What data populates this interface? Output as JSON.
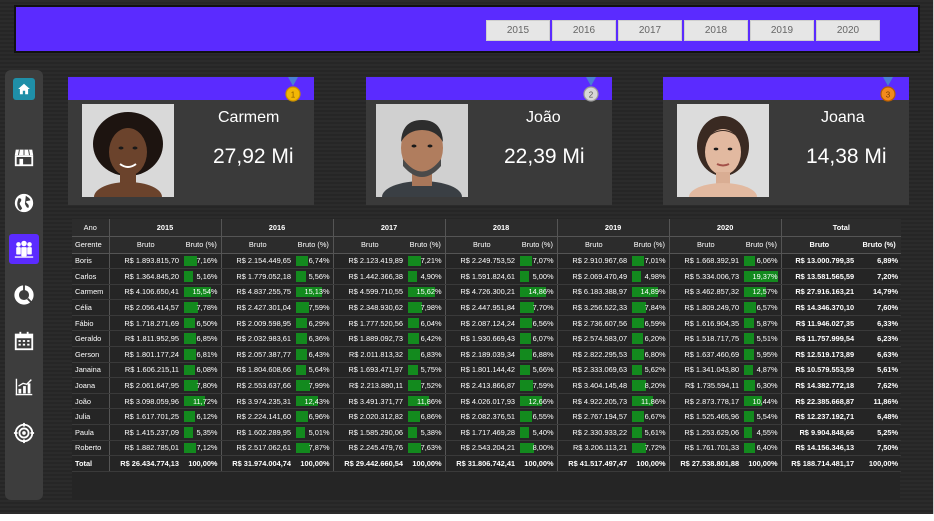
{
  "years": [
    "2015",
    "2016",
    "2017",
    "2018",
    "2019",
    "2020"
  ],
  "cards": [
    {
      "name": "Carmem",
      "value": "27,92 Mi",
      "medal": "1"
    },
    {
      "name": "João",
      "value": "22,39 Mi",
      "medal": "2"
    },
    {
      "name": "Joana",
      "value": "14,38 Mi",
      "medal": "3"
    }
  ],
  "table": {
    "col_ano": "Ano",
    "col_gerente": "Gerente",
    "col_total": "Total",
    "sub_bruto": "Bruto",
    "sub_pct": "Bruto (%)",
    "rows": [
      {
        "name": "Boris",
        "cells": [
          [
            "R$ 1.893.815,70",
            "7,16%"
          ],
          [
            "R$ 2.154.449,65",
            "6,74%"
          ],
          [
            "R$ 2.123.419,89",
            "7,21%"
          ],
          [
            "R$ 2.249.753,52",
            "7,07%"
          ],
          [
            "R$ 2.910.967,68",
            "7,01%"
          ],
          [
            "R$ 1.668.392,91",
            "6,06%"
          ]
        ],
        "total": [
          "R$ 13.000.799,35",
          "6,89%"
        ]
      },
      {
        "name": "Carlos",
        "cells": [
          [
            "R$ 1.364.845,20",
            "5,16%"
          ],
          [
            "R$ 1.779.052,18",
            "5,56%"
          ],
          [
            "R$ 1.442.366,38",
            "4,90%"
          ],
          [
            "R$ 1.591.824,61",
            "5,00%"
          ],
          [
            "R$ 2.069.470,49",
            "4,98%"
          ],
          [
            "R$ 5.334.006,73",
            "19,37%"
          ]
        ],
        "total": [
          "R$ 13.581.565,59",
          "7,20%"
        ]
      },
      {
        "name": "Carmem",
        "cells": [
          [
            "R$ 4.106.650,41",
            "15,54%"
          ],
          [
            "R$ 4.837.255,75",
            "15,13%"
          ],
          [
            "R$ 4.599.710,55",
            "15,62%"
          ],
          [
            "R$ 4.726.300,21",
            "14,86%"
          ],
          [
            "R$ 6.183.388,97",
            "14,89%"
          ],
          [
            "R$ 3.462.857,32",
            "12,57%"
          ]
        ],
        "total": [
          "R$ 27.916.163,21",
          "14,79%"
        ]
      },
      {
        "name": "Célia",
        "cells": [
          [
            "R$ 2.056.414,57",
            "7,78%"
          ],
          [
            "R$ 2.427.301,04",
            "7,59%"
          ],
          [
            "R$ 2.348.930,62",
            "7,98%"
          ],
          [
            "R$ 2.447.951,84",
            "7,70%"
          ],
          [
            "R$ 3.256.522,33",
            "7,84%"
          ],
          [
            "R$ 1.809.249,70",
            "6,57%"
          ]
        ],
        "total": [
          "R$ 14.346.370,10",
          "7,60%"
        ]
      },
      {
        "name": "Fábio",
        "cells": [
          [
            "R$ 1.718.271,69",
            "6,50%"
          ],
          [
            "R$ 2.009.598,95",
            "6,29%"
          ],
          [
            "R$ 1.777.520,56",
            "6,04%"
          ],
          [
            "R$ 2.087.124,24",
            "6,56%"
          ],
          [
            "R$ 2.736.607,56",
            "6,59%"
          ],
          [
            "R$ 1.616.904,35",
            "5,87%"
          ]
        ],
        "total": [
          "R$ 11.946.027,35",
          "6,33%"
        ]
      },
      {
        "name": "Geraldo",
        "cells": [
          [
            "R$ 1.811.952,95",
            "6,85%"
          ],
          [
            "R$ 2.032.983,61",
            "6,36%"
          ],
          [
            "R$ 1.889.092,73",
            "6,42%"
          ],
          [
            "R$ 1.930.669,43",
            "6,07%"
          ],
          [
            "R$ 2.574.583,07",
            "6,20%"
          ],
          [
            "R$ 1.518.717,75",
            "5,51%"
          ]
        ],
        "total": [
          "R$ 11.757.999,54",
          "6,23%"
        ]
      },
      {
        "name": "Gerson",
        "cells": [
          [
            "R$ 1.801.177,24",
            "6,81%"
          ],
          [
            "R$ 2.057.387,77",
            "6,43%"
          ],
          [
            "R$ 2.011.813,32",
            "6,83%"
          ],
          [
            "R$ 2.189.039,34",
            "6,88%"
          ],
          [
            "R$ 2.822.295,53",
            "6,80%"
          ],
          [
            "R$ 1.637.460,69",
            "5,95%"
          ]
        ],
        "total": [
          "R$ 12.519.173,89",
          "6,63%"
        ]
      },
      {
        "name": "Janaina",
        "cells": [
          [
            "R$ 1.606.215,11",
            "6,08%"
          ],
          [
            "R$ 1.804.608,66",
            "5,64%"
          ],
          [
            "R$ 1.693.471,97",
            "5,75%"
          ],
          [
            "R$ 1.801.144,42",
            "5,66%"
          ],
          [
            "R$ 2.333.069,63",
            "5,62%"
          ],
          [
            "R$ 1.341.043,80",
            "4,87%"
          ]
        ],
        "total": [
          "R$ 10.579.553,59",
          "5,61%"
        ]
      },
      {
        "name": "Joana",
        "cells": [
          [
            "R$ 2.061.647,95",
            "7,80%"
          ],
          [
            "R$ 2.553.637,66",
            "7,99%"
          ],
          [
            "R$ 2.213.880,11",
            "7,52%"
          ],
          [
            "R$ 2.413.866,87",
            "7,59%"
          ],
          [
            "R$ 3.404.145,48",
            "8,20%"
          ],
          [
            "R$ 1.735.594,11",
            "6,30%"
          ]
        ],
        "total": [
          "R$ 14.382.772,18",
          "7,62%"
        ]
      },
      {
        "name": "João",
        "cells": [
          [
            "R$ 3.098.059,96",
            "11,72%"
          ],
          [
            "R$ 3.974.235,31",
            "12,43%"
          ],
          [
            "R$ 3.491.371,77",
            "11,86%"
          ],
          [
            "R$ 4.026.017,93",
            "12,66%"
          ],
          [
            "R$ 4.922.205,73",
            "11,86%"
          ],
          [
            "R$ 2.873.778,17",
            "10,44%"
          ]
        ],
        "total": [
          "R$ 22.385.668,87",
          "11,86%"
        ]
      },
      {
        "name": "Julia",
        "cells": [
          [
            "R$ 1.617.701,25",
            "6,12%"
          ],
          [
            "R$ 2.224.141,60",
            "6,96%"
          ],
          [
            "R$ 2.020.312,82",
            "6,86%"
          ],
          [
            "R$ 2.082.376,51",
            "6,55%"
          ],
          [
            "R$ 2.767.194,57",
            "6,67%"
          ],
          [
            "R$ 1.525.465,96",
            "5,54%"
          ]
        ],
        "total": [
          "R$ 12.237.192,71",
          "6,48%"
        ]
      },
      {
        "name": "Paula",
        "cells": [
          [
            "R$ 1.415.237,09",
            "5,35%"
          ],
          [
            "R$ 1.602.289,95",
            "5,01%"
          ],
          [
            "R$ 1.585.290,06",
            "5,38%"
          ],
          [
            "R$ 1.717.469,28",
            "5,40%"
          ],
          [
            "R$ 2.330.933,22",
            "5,61%"
          ],
          [
            "R$ 1.253.629,06",
            "4,55%"
          ]
        ],
        "total": [
          "R$ 9.904.848,66",
          "5,25%"
        ]
      },
      {
        "name": "Roberto",
        "cells": [
          [
            "R$ 1.882.785,01",
            "7,12%"
          ],
          [
            "R$ 2.517.062,61",
            "7,87%"
          ],
          [
            "R$ 2.245.479,76",
            "7,63%"
          ],
          [
            "R$ 2.543.204,21",
            "8,00%"
          ],
          [
            "R$ 3.206.113,21",
            "7,72%"
          ],
          [
            "R$ 1.761.701,33",
            "6,40%"
          ]
        ],
        "total": [
          "R$ 14.156.346,13",
          "7,50%"
        ]
      }
    ],
    "total_row": {
      "name": "Total",
      "cells": [
        [
          "R$ 26.434.774,13",
          "100,00%"
        ],
        [
          "R$ 31.974.004,74",
          "100,00%"
        ],
        [
          "R$ 29.442.660,54",
          "100,00%"
        ],
        [
          "R$ 31.806.742,41",
          "100,00%"
        ],
        [
          "R$ 41.517.497,47",
          "100,00%"
        ],
        [
          "R$ 27.538.801,88",
          "100,00%"
        ]
      ],
      "total": [
        "R$ 188.714.481,17",
        "100,00%"
      ]
    }
  },
  "colors": {
    "accent": "#5b2bff",
    "bar": "#138a1e"
  },
  "icons": [
    "home-icon",
    "store-icon",
    "globe-icon",
    "people-icon",
    "donut-chart-icon",
    "calendar-icon",
    "bar-chart-icon",
    "target-icon"
  ]
}
